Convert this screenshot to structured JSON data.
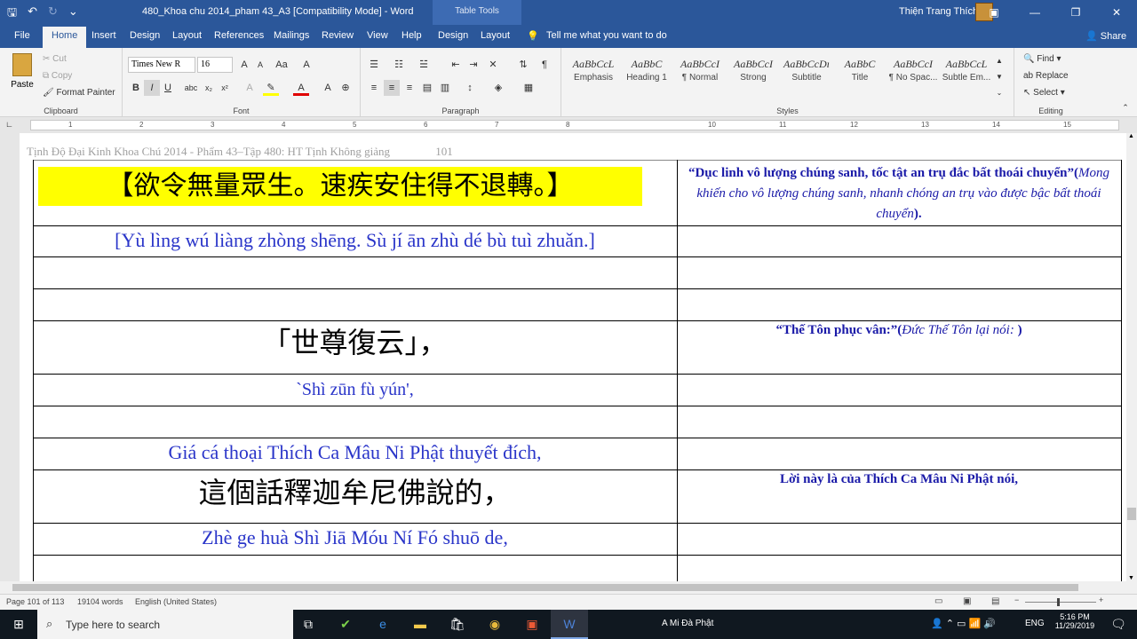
{
  "window": {
    "title": "480_Khoa chu 2014_pham 43_A3 [Compatibility Mode]  -  Word",
    "table_tools": "Table Tools",
    "user": "Thiện Trang Thích"
  },
  "ribbon_tabs": {
    "file": "File",
    "home": "Home",
    "insert": "Insert",
    "design": "Design",
    "layout": "Layout",
    "references": "References",
    "mailings": "Mailings",
    "review": "Review",
    "view": "View",
    "help": "Help",
    "tdesign": "Design",
    "tlayout": "Layout",
    "tell": "Tell me what you want to do",
    "share": "Share"
  },
  "clipboard": {
    "paste": "Paste",
    "cut": "Cut",
    "copy": "Copy",
    "format_painter": "Format Painter",
    "label": "Clipboard"
  },
  "font": {
    "name": "Times New R",
    "size": "16",
    "label": "Font"
  },
  "paragraph": {
    "label": "Paragraph"
  },
  "styles": {
    "label": "Styles",
    "items": [
      {
        "sample": "AaBbCcL",
        "name": "Emphasis"
      },
      {
        "sample": "AaBbC",
        "name": "Heading 1"
      },
      {
        "sample": "AaBbCcI",
        "name": "¶ Normal"
      },
      {
        "sample": "AaBbCcI",
        "name": "Strong"
      },
      {
        "sample": "AaBbCcDı",
        "name": "Subtitle"
      },
      {
        "sample": "AaBbC",
        "name": "Title"
      },
      {
        "sample": "AaBbCcI",
        "name": "¶ No Spac..."
      },
      {
        "sample": "AaBbCcL",
        "name": "Subtle Em..."
      }
    ]
  },
  "editing": {
    "find": "Find",
    "replace": "Replace",
    "select": "Select",
    "label": "Editing"
  },
  "ruler_numbers": [
    "1",
    "2",
    "3",
    "4",
    "5",
    "6",
    "7",
    "8",
    "10",
    "11",
    "12",
    "13",
    "14",
    "15"
  ],
  "document": {
    "header": "Tịnh Độ Đại Kinh Khoa Chú 2014 - Phẩm 43–Tập 480: HT Tịnh Không giảng",
    "page_number": "101",
    "rows": [
      {
        "left": "【欲令無量眾生。速疾安住得不退轉。】",
        "right_bold": "“Dục linh vô lượng chúng sanh, tốc tật an trụ đắc bất thoái chuyển”(",
        "right_italic": "Mong khiến cho vô lượng chúng sanh, nhanh chóng an trụ vào được bậc bất thoái chuyển",
        "right_end": ")."
      },
      {
        "left": "[Yù lìng wú liàng zhòng shēng. Sù jí ān zhù dé bù tuì zhuǎn.]"
      },
      {
        "left": "「世尊復云」，",
        "right_bold": "“Thế Tôn phục vân:”(",
        "right_italic": "Đức Thế Tôn lại nói: ",
        "right_end": ")"
      },
      {
        "left": "`Shì zūn fù yún',"
      },
      {
        "left": "Giá cá thoại Thích Ca Mâu Ni Phật thuyết đích,"
      },
      {
        "left": "這個話釋迦牟尼佛說的，",
        "right_bold": "Lời này là của Thích Ca Mâu Ni Phật nói,"
      },
      {
        "left": "Zhè ge huà Shì Jiā Móu Ní Fó shuō de,"
      }
    ]
  },
  "status": {
    "page": "Page 101 of 113",
    "words": "19104 words",
    "language": "English (United States)"
  },
  "taskbar": {
    "search": "Type here to search",
    "app_title": "A Mi Đà Phật",
    "lang": "ENG",
    "time": "5:16 PM",
    "date": "11/29/2019"
  }
}
